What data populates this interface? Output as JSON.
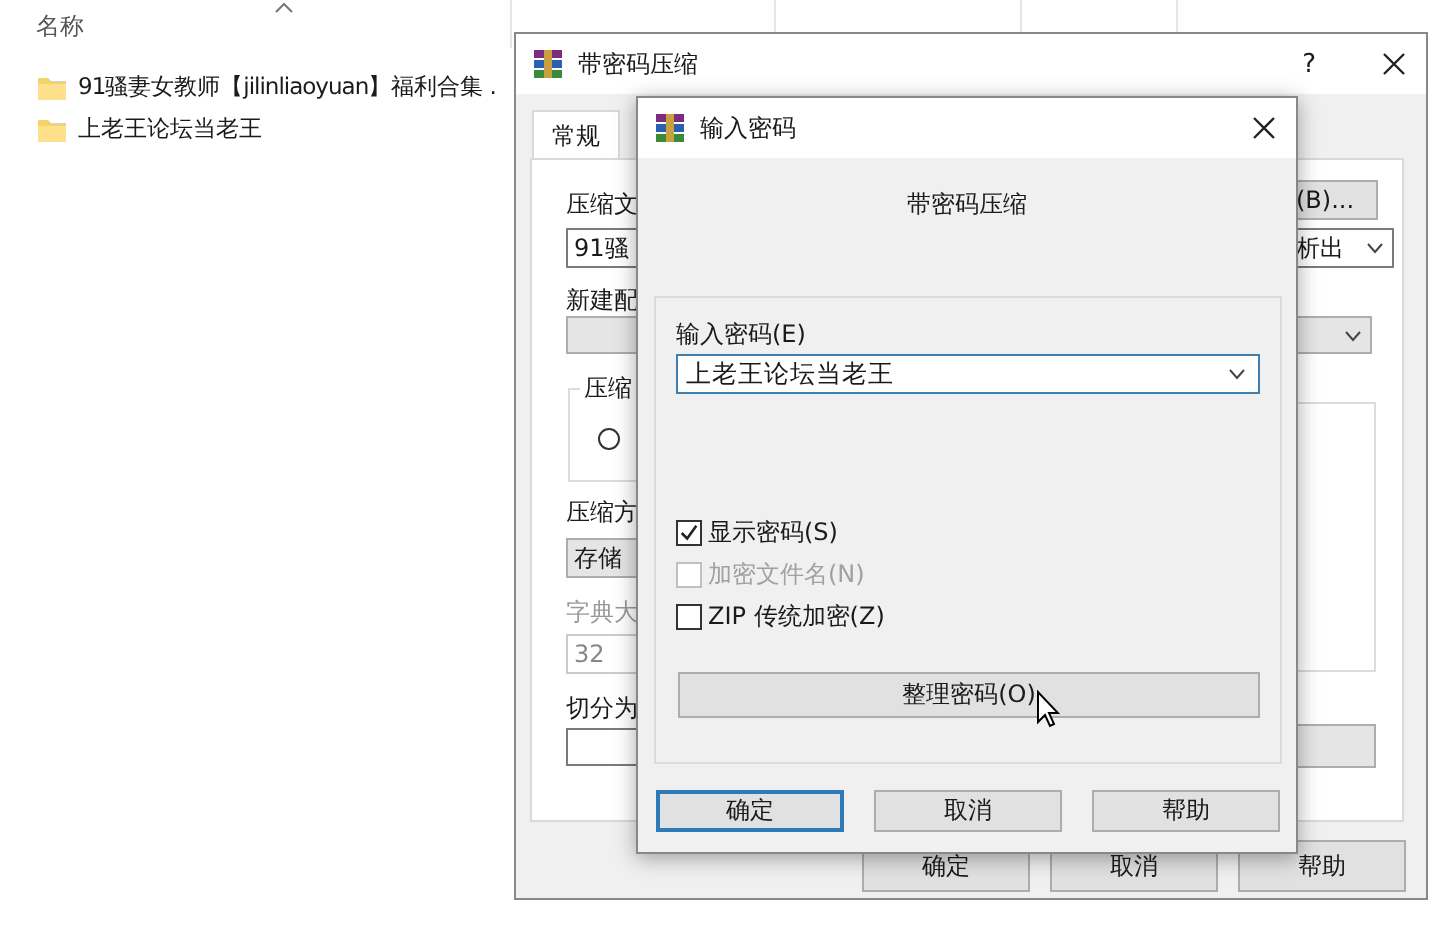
{
  "explorer": {
    "columns": [
      "名称"
    ],
    "items": [
      {
        "name": "91骚妻女教师【jilinliaoyuan】福利合集 ."
      },
      {
        "name": "上老王论坛当老王"
      }
    ]
  },
  "archive_dialog": {
    "title": "带密码压缩",
    "help": "?",
    "tabs": [
      {
        "label": "常规",
        "selected": true
      }
    ],
    "archive_label": "压缩文",
    "archive_field": "91骚",
    "browse_button": "(B)...",
    "update_mode": "析出",
    "profile_label": "新建配",
    "group_legend": "压缩",
    "radio": {
      "selected": false
    },
    "method_label": "压缩方",
    "method": "存储",
    "dictionary_label": "字典大",
    "dictionary": "32",
    "dictionary_disabled": true,
    "split_label": "切分为",
    "buttons": [
      "确定",
      "取消",
      "帮助"
    ]
  },
  "password_dialog": {
    "title": "输入密码",
    "subtitle": "带密码压缩",
    "password_label": "输入密码(E)",
    "password": "上老王论坛当老王",
    "options": [
      {
        "label": "显示密码(S)",
        "checked": true,
        "disabled": false
      },
      {
        "label": "加密文件名(N)",
        "checked": false,
        "disabled": true
      },
      {
        "label": "ZIP 传统加密(Z)",
        "checked": false,
        "disabled": false
      }
    ],
    "organize_button": "整理密码(O)",
    "buttons": [
      {
        "label": "确定",
        "focused": true
      },
      {
        "label": "取消",
        "focused": false
      },
      {
        "label": "帮助",
        "focused": false
      }
    ]
  }
}
